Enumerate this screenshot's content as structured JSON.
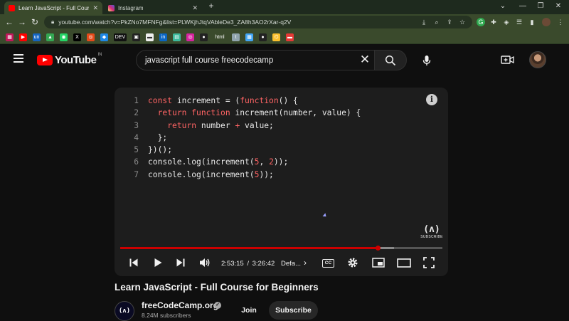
{
  "browser": {
    "tabs": [
      {
        "title": "Learn JavaScript - Full Course for Beginners",
        "active": true,
        "favicon_color": "#ff0000"
      },
      {
        "title": "Instagram",
        "active": false,
        "favicon_color": "#d6249f"
      }
    ],
    "new_tab_label": "+",
    "url": "youtube.com/watch?v=PkZNo7MFNFg&list=PLWKjhJtqVAbleDe3_ZA8h3AO2rXar-q2V",
    "bookmarks": [
      {
        "label": "▦",
        "color": "#c2185b"
      },
      {
        "label": "▶",
        "color": "#ff0000"
      },
      {
        "label": "un",
        "color": "#1565c0"
      },
      {
        "label": "▲",
        "color": "#34a853"
      },
      {
        "label": "◉",
        "color": "#25d366"
      },
      {
        "label": "X",
        "color": "#000000"
      },
      {
        "label": "◎",
        "color": "#e64a19"
      },
      {
        "label": "◆",
        "color": "#1e88e5"
      },
      {
        "label": "DEV",
        "color": "#111111"
      },
      {
        "label": "▣",
        "color": "#222222"
      },
      {
        "label": "▬",
        "color": "#eeeeee"
      },
      {
        "label": "in",
        "color": "#0a66c2"
      },
      {
        "label": "▤",
        "color": "#3dba9d"
      },
      {
        "label": "◎",
        "color": "#d6249f"
      },
      {
        "label": "●",
        "color": "#222222"
      },
      {
        "label": "html",
        "color": "transparent"
      },
      {
        "label": "t",
        "color": "#90a4ae"
      },
      {
        "label": "▦",
        "color": "#42a5f5"
      },
      {
        "label": "●",
        "color": "#222222"
      },
      {
        "label": "⌬",
        "color": "#fbc02d"
      },
      {
        "label": "▬",
        "color": "#e53935"
      }
    ]
  },
  "youtube": {
    "logo_text": "YouTube",
    "country_code": "IN",
    "search_value": "javascript full course freecodecamp",
    "icons": {
      "menu": "hamburger-icon",
      "clear": "close-icon",
      "search": "search-icon",
      "mic": "microphone-icon",
      "create": "video-camera-plus-icon"
    }
  },
  "player": {
    "code_lines": [
      {
        "n": "1",
        "tokens": [
          {
            "t": "const ",
            "c": "kw"
          },
          {
            "t": "increment = (",
            "c": ""
          },
          {
            "t": "function",
            "c": "kw"
          },
          {
            "t": "() {",
            "c": ""
          }
        ]
      },
      {
        "n": "2",
        "tokens": [
          {
            "t": "  ",
            "c": ""
          },
          {
            "t": "return ",
            "c": "kw"
          },
          {
            "t": "function ",
            "c": "kw"
          },
          {
            "t": "increment(number, value) {",
            "c": ""
          }
        ]
      },
      {
        "n": "3",
        "tokens": [
          {
            "t": "    ",
            "c": ""
          },
          {
            "t": "return ",
            "c": "kw"
          },
          {
            "t": "number ",
            "c": ""
          },
          {
            "t": "+ ",
            "c": "kw"
          },
          {
            "t": "value;",
            "c": ""
          }
        ]
      },
      {
        "n": "4",
        "tokens": [
          {
            "t": "  };",
            "c": ""
          }
        ]
      },
      {
        "n": "5",
        "tokens": [
          {
            "t": "})();",
            "c": ""
          }
        ]
      },
      {
        "n": "6",
        "tokens": [
          {
            "t": "console.log(increment(",
            "c": ""
          },
          {
            "t": "5",
            "c": "num"
          },
          {
            "t": ", ",
            "c": ""
          },
          {
            "t": "2",
            "c": "num"
          },
          {
            "t": "));",
            "c": ""
          }
        ]
      },
      {
        "n": "7",
        "tokens": [
          {
            "t": "console.log(increment(",
            "c": ""
          },
          {
            "t": "5",
            "c": "num"
          },
          {
            "t": "));",
            "c": ""
          }
        ]
      }
    ],
    "info_glyph": "i",
    "watermark_glyph": "(ʌ)",
    "watermark_text": "SUBSCRIBE",
    "progress_fraction": 0.8,
    "buffered_fraction": 0.85,
    "current_time": "2:53:15",
    "time_separator": "/",
    "duration": "3:26:42",
    "chapter": "Defa...",
    "chapter_chevron": "›",
    "cc_label": "CC",
    "accent_color": "#cc0000"
  },
  "video": {
    "title": "Learn JavaScript - Full Course for Beginners",
    "channel_name": "freeCodeCamp.org",
    "channel_avatar_glyph": "(ʌ)",
    "verified_glyph": "✓",
    "subscribers": "8.24M subscribers",
    "join_label": "Join",
    "subscribe_label": "Subscribe"
  }
}
